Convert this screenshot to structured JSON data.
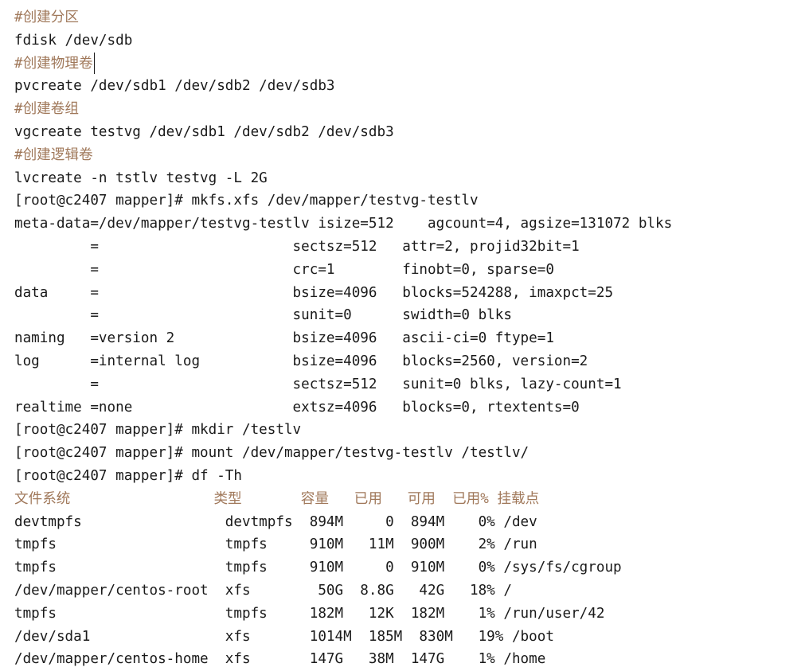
{
  "lines": [
    "#创建分区",
    "fdisk /dev/sdb",
    "#创建物理卷",
    "pvcreate /dev/sdb1 /dev/sdb2 /dev/sdb3",
    "#创建卷组",
    "vgcreate testvg /dev/sdb1 /dev/sdb2 /dev/sdb3",
    "#创建逻辑卷",
    "lvcreate -n tstlv testvg -L 2G",
    "[root@c2407 mapper]# mkfs.xfs /dev/mapper/testvg-testlv",
    "meta-data=/dev/mapper/testvg-testlv isize=512    agcount=4, agsize=131072 blks",
    "         =                       sectsz=512   attr=2, projid32bit=1",
    "         =                       crc=1        finobt=0, sparse=0",
    "data     =                       bsize=4096   blocks=524288, imaxpct=25",
    "         =                       sunit=0      swidth=0 blks",
    "naming   =version 2              bsize=4096   ascii-ci=0 ftype=1",
    "log      =internal log           bsize=4096   blocks=2560, version=2",
    "         =                       sectsz=512   sunit=0 blks, lazy-count=1",
    "realtime =none                   extsz=4096   blocks=0, rtextents=0",
    "[root@c2407 mapper]# mkdir /testlv",
    "[root@c2407 mapper]# mount /dev/mapper/testvg-testlv /testlv/",
    "[root@c2407 mapper]# df -Th",
    "文件系统                 类型       容量   已用   可用  已用% 挂载点",
    "devtmpfs                 devtmpfs  894M     0  894M    0% /dev",
    "tmpfs                    tmpfs     910M   11M  900M    2% /run",
    "tmpfs                    tmpfs     910M     0  910M    0% /sys/fs/cgroup",
    "/dev/mapper/centos-root  xfs        50G  8.8G   42G   18% /",
    "tmpfs                    tmpfs     182M   12K  182M    1% /run/user/42",
    "/dev/sda1                xfs       1014M  185M  830M   19% /boot",
    "/dev/mapper/centos-home  xfs       147G   38M  147G    1% /home"
  ]
}
